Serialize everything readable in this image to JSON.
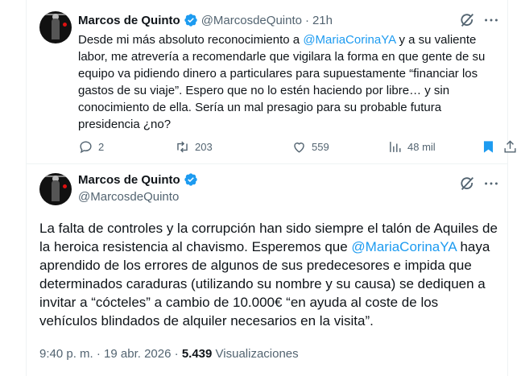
{
  "tweet1": {
    "author_name": "Marcos de Quinto",
    "handle": "@MarcosdeQuinto",
    "separator": "·",
    "time": "21h",
    "text_before": "Desde mi más absoluto reconocimiento a ",
    "mention": "@MariaCorinaYA",
    "text_after": " y a su valiente labor, me atrevería a recomendarle que vigilara la forma en que gente de su equipo va pidiendo dinero a particulares para supuestamente “financiar los gastos de su viaje”. Espero que no lo estén haciendo por libre… y sin conocimiento de ella. Sería un mal presagio para su probable futura presidencia ¿no?",
    "replies": "2",
    "reposts": "203",
    "likes": "559",
    "views": "48 mil",
    "bookmark_color": "#1d9bf0"
  },
  "tweet2": {
    "author_name": "Marcos de Quinto",
    "handle": "@MarcosdeQuinto",
    "text_before": "La falta de controles y la corrupción han sido siempre el talón de Aquiles de la heroica resistencia al chavismo. Esperemos que ",
    "mention": "@MariaCorinaYA",
    "text_after": " haya aprendido de los errores de algunos de sus predecesores e impida que determinados caraduras (utilizando su nombre y su causa) se dediquen a invitar a “cócteles” a cambio de 10.000€ “en ayuda al coste de los vehículos blindados de alquiler necesarios en la visita”.",
    "time": "9:40 p. m.",
    "separator1": "·",
    "date": "19 abr. 2026",
    "separator2": "·",
    "views_count": "5.439",
    "views_label": "Visualizaciones"
  },
  "colors": {
    "accent": "#1d9bf0",
    "muted": "#536471",
    "text": "#0f1419"
  },
  "icons": [
    "verified-badge-icon",
    "grok-icon",
    "more-icon",
    "reply-icon",
    "repost-icon",
    "like-icon",
    "views-icon",
    "bookmark-icon",
    "share-icon"
  ]
}
